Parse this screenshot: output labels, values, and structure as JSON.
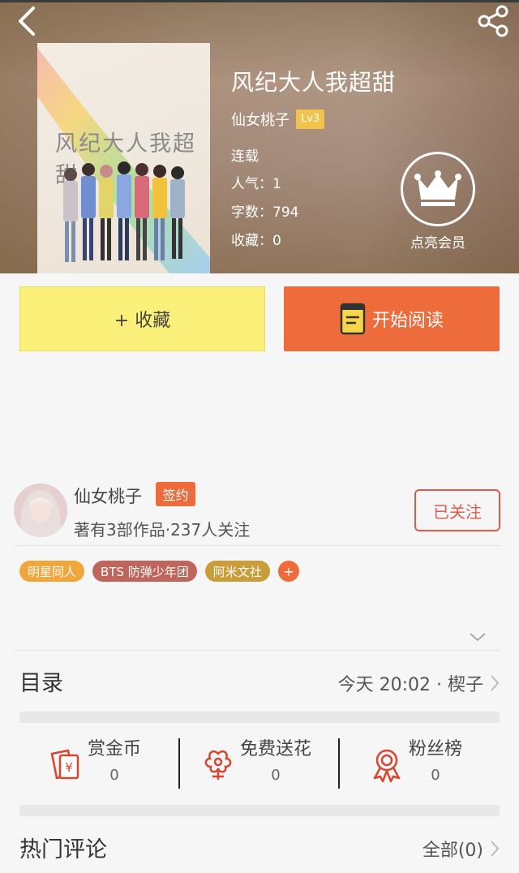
{
  "header": {
    "back_icon": "chevron-left-icon",
    "share_icon": "share-icon"
  },
  "book": {
    "cover_title": "风纪大人我超甜",
    "title": "风纪大人我超甜",
    "author": "仙女桃子",
    "level": "Lv3",
    "status": "连载",
    "popularity": "人气：1",
    "word_count": "字数：794",
    "favorites": "收藏：0"
  },
  "vip": {
    "icon": "crown-icon",
    "label": "点亮会员"
  },
  "actions": {
    "favorite_label": "+ 收藏",
    "read_label": "开始阅读",
    "read_icon": "book-icon"
  },
  "author_card": {
    "name": "仙女桃子",
    "badge": "签约",
    "stats": "著有3部作品·237人关注",
    "follow_label": "已关注"
  },
  "tags": [
    {
      "label": "明星同人",
      "color": "#f0a63a"
    },
    {
      "label": "BTS 防弹少年团",
      "color": "#c0655c"
    },
    {
      "label": "阿米文社",
      "color": "#c99e3a"
    }
  ],
  "tag_more": "+",
  "toc": {
    "title": "目录",
    "latest": "今天 20:02 · 楔子"
  },
  "stats": [
    {
      "label": "赏金币",
      "value": "0",
      "icon": "red-envelope-icon"
    },
    {
      "label": "免费送花",
      "value": "0",
      "icon": "flower-icon"
    },
    {
      "label": "粉丝榜",
      "value": "0",
      "icon": "medal-icon"
    }
  ],
  "comments": {
    "title": "热门评论",
    "all_label": "全部(0)"
  },
  "colors": {
    "accent": "#ee6b3b",
    "favorite_bg": "#fbf17a",
    "follow_red": "#e25a4c"
  }
}
